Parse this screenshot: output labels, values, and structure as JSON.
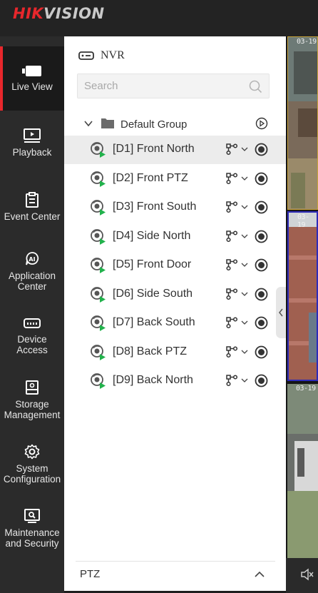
{
  "brand": {
    "part1": "HIK",
    "part2": "VISION"
  },
  "nav": {
    "items": [
      {
        "id": "live-view",
        "label": "Live View",
        "icon": "camera-icon",
        "active": true
      },
      {
        "id": "playback",
        "label": "Playback",
        "icon": "playback-icon"
      },
      {
        "id": "event-center",
        "label": "Event Center",
        "icon": "clipboard-icon"
      },
      {
        "id": "application-center",
        "label": "Application\nCenter",
        "icon": "ai-icon"
      },
      {
        "id": "device-access",
        "label": "Device\nAccess",
        "icon": "device-icon"
      },
      {
        "id": "storage-management",
        "label": "Storage\nManagement",
        "icon": "storage-icon"
      },
      {
        "id": "system-configuration",
        "label": "System\nConfiguration",
        "icon": "gear-icon"
      },
      {
        "id": "maintenance-security",
        "label": "Maintenance\nand Security",
        "icon": "maintenance-icon"
      }
    ]
  },
  "panel": {
    "device_name": "NVR",
    "search_placeholder": "Search",
    "group": {
      "name": "Default Group",
      "expanded": true
    },
    "cameras": [
      {
        "label": "[D1] Front North",
        "selected": true
      },
      {
        "label": "[D2] Front PTZ"
      },
      {
        "label": "[D3] Front South"
      },
      {
        "label": "[D4] Side North"
      },
      {
        "label": "[D5] Front Door"
      },
      {
        "label": "[D6] Side South"
      },
      {
        "label": "[D7] Back South"
      },
      {
        "label": "[D8] Back PTZ"
      },
      {
        "label": "[D9] Back North"
      }
    ],
    "ptz_label": "PTZ"
  },
  "video": {
    "tiles": [
      {
        "timestamp": "03-19",
        "border": "#c8a23a"
      },
      {
        "timestamp": "03-19",
        "border": "#2d2ab8"
      },
      {
        "timestamp": "03-19",
        "border": "none"
      }
    ]
  },
  "colors": {
    "accent": "#e8272c",
    "live_green": "#22b24c",
    "nav_bg": "#2b2b2b",
    "topbar_bg": "#232323"
  }
}
